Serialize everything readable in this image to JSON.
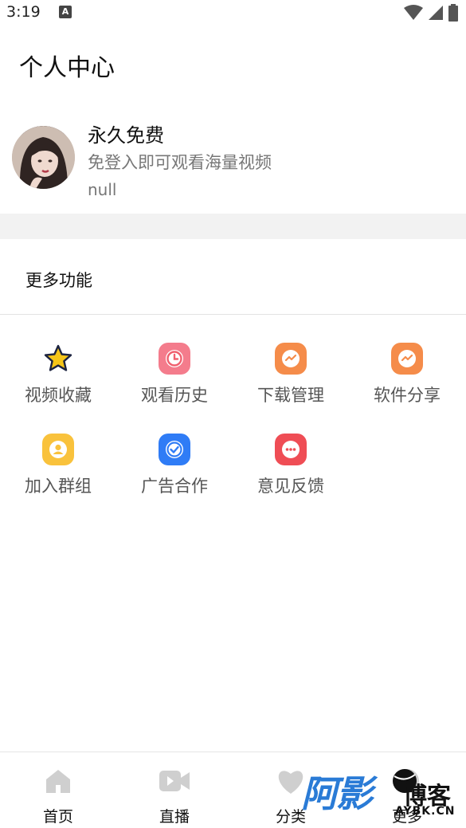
{
  "status": {
    "time": "3:19",
    "a_badge": "A"
  },
  "page_title": "个人中心",
  "profile": {
    "name": "永久免费",
    "subtitle": "免登入即可观看海量视频",
    "extra": "null"
  },
  "section_title": "更多功能",
  "grid": [
    {
      "label": "视频收藏",
      "icon": "star-icon",
      "color": "#f5c518"
    },
    {
      "label": "观看历史",
      "icon": "clock-icon",
      "color": "#f47c8c"
    },
    {
      "label": "下载管理",
      "icon": "chat-bubble-icon",
      "color": "#f58c4a"
    },
    {
      "label": "软件分享",
      "icon": "chat-bubble-icon",
      "color": "#f58c4a"
    },
    {
      "label": "加入群组",
      "icon": "user-icon",
      "color": "#f9c23c"
    },
    {
      "label": "广告合作",
      "icon": "check-circle-icon",
      "color": "#2f7cf6"
    },
    {
      "label": "意见反馈",
      "icon": "ellipsis-icon",
      "color": "#ef4d55"
    }
  ],
  "tabs": [
    {
      "label": "首页",
      "icon": "home-icon"
    },
    {
      "label": "直播",
      "icon": "video-icon"
    },
    {
      "label": "分类",
      "icon": "heart-icon"
    },
    {
      "label": "更多",
      "icon": "more-icon"
    }
  ],
  "watermark": {
    "text": "阿影",
    "text2": "博客",
    "url": "AYBK.CN"
  },
  "colors": {
    "divider": "#e3e3e3",
    "section_bg": "#f2f2f2",
    "tab_icon": "#cfcfcf"
  }
}
